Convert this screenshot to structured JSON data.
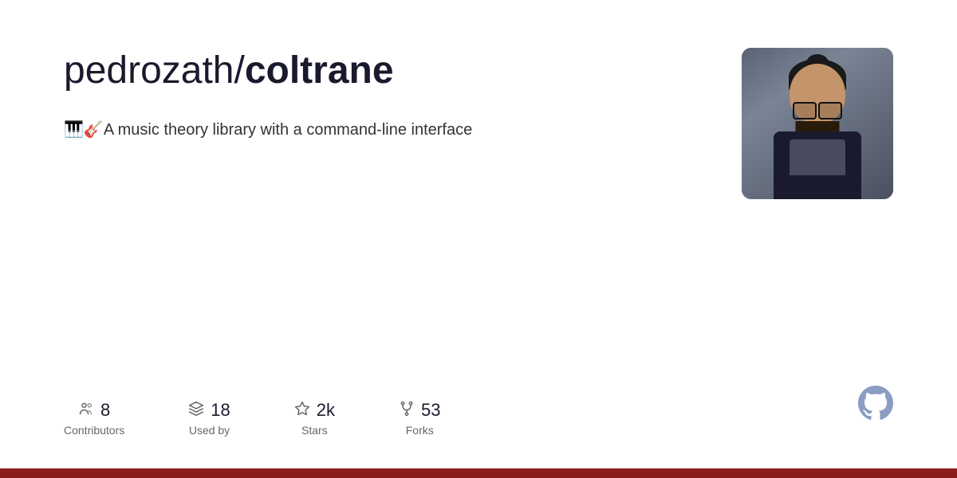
{
  "repo": {
    "owner": "pedrozath/",
    "name": "coltrane",
    "description_emoji": "🎹🎸",
    "description_text": "A music theory library with a command-line interface"
  },
  "stats": [
    {
      "id": "contributors",
      "number": "8",
      "label": "Contributors",
      "icon": "people-icon"
    },
    {
      "id": "used-by",
      "number": "18",
      "label": "Used by",
      "icon": "package-icon"
    },
    {
      "id": "stars",
      "number": "2k",
      "label": "Stars",
      "icon": "star-icon"
    },
    {
      "id": "forks",
      "number": "53",
      "label": "Forks",
      "icon": "fork-icon"
    }
  ],
  "bottom_bar_color": "#8b1c1c",
  "github_logo": "github-icon"
}
